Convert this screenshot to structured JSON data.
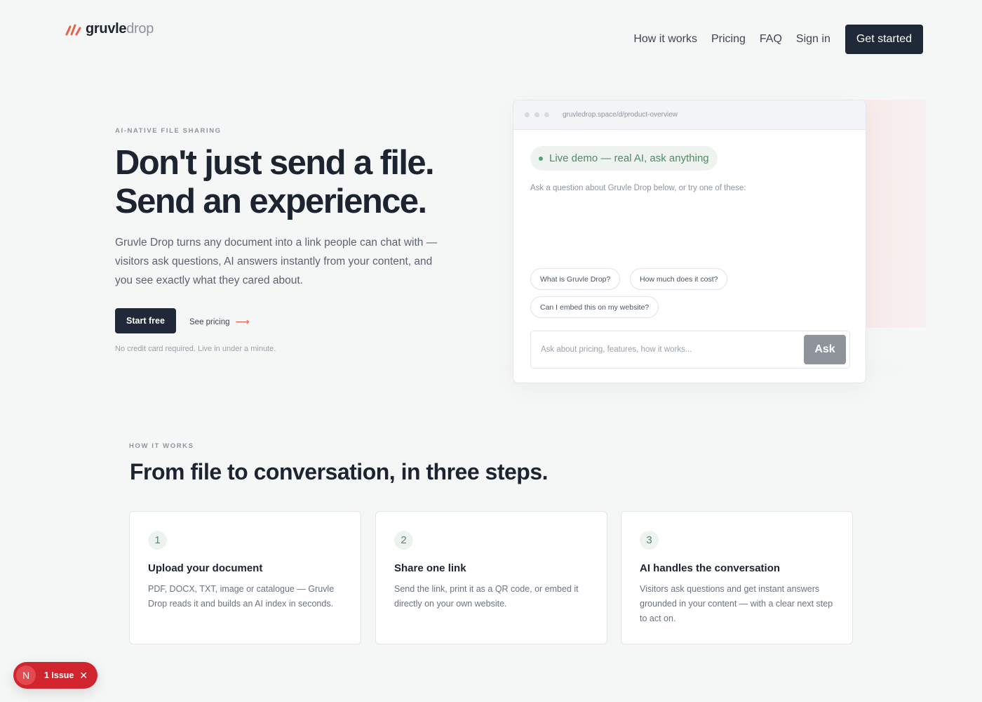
{
  "brand": {
    "name_bold": "gruvle",
    "name_light": "drop",
    "logo_icon": "slash-bars-icon",
    "accent": "#e9614d"
  },
  "nav": {
    "links": [
      "How it works",
      "Pricing",
      "FAQ",
      "Sign in"
    ],
    "cta": "Get started"
  },
  "hero": {
    "eyebrow": "AI-NATIVE FILE SHARING",
    "title_line1": "Don't just send a file.",
    "title_line2": "Send an experience.",
    "description": "Gruvle Drop turns any document into a link people can chat with — visitors ask questions, AI answers instantly from your content, and you see exactly what they cared about.",
    "primary_cta": "Start free",
    "secondary_cta": "See pricing",
    "secondary_icon": "arrow-right-icon",
    "note": "No credit card required. Live in under a minute."
  },
  "demo": {
    "url": "gruvledrop.space/d/product-overview",
    "live_label": "Live demo — real AI, ask anything",
    "intro": "Ask a question about Gruvle Drop below, or try one of these:",
    "suggestions": [
      "What is Gruvle Drop?",
      "How much does it cost?",
      "Can I embed this on my website?"
    ],
    "input_placeholder": "Ask about pricing, features, how it works...",
    "ask_button": "Ask"
  },
  "how": {
    "eyebrow": "HOW IT WORKS",
    "title": "From file to conversation, in three steps.",
    "steps": [
      {
        "num": "1",
        "title": "Upload your document",
        "desc": "PDF, DOCX, TXT, image or catalogue — Gruvle Drop reads it and builds an AI index in seconds."
      },
      {
        "num": "2",
        "title": "Share one link",
        "desc": "Send the link, print it as a QR code, or embed it directly on your own website."
      },
      {
        "num": "3",
        "title": "AI handles the conversation",
        "desc": "Visitors ask questions and get instant answers grounded in your content — with a clear next step to act on."
      }
    ]
  },
  "issue_badge": {
    "avatar_letter": "N",
    "label": "1 Issue",
    "close_icon": "close-icon"
  }
}
